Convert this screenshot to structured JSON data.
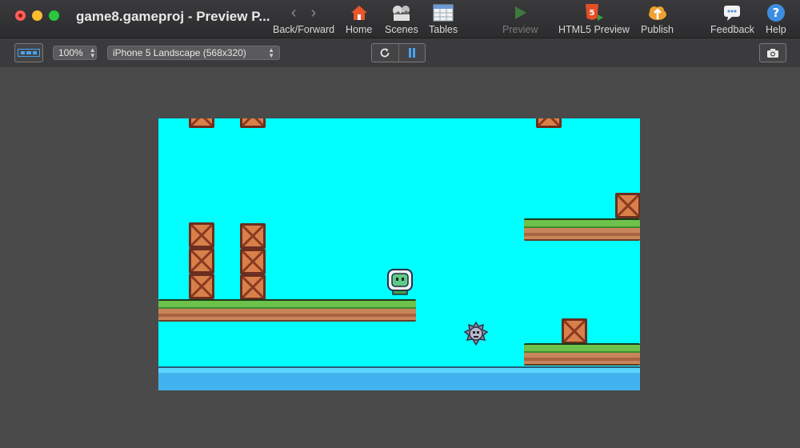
{
  "window": {
    "title": "game8.gameproj - Preview P..."
  },
  "toolbar": {
    "back_forward_label": "Back/Forward",
    "home_label": "Home",
    "scenes_label": "Scenes",
    "tables_label": "Tables",
    "preview_label": "Preview",
    "html5_preview_label": "HTML5 Preview",
    "publish_label": "Publish",
    "feedback_label": "Feedback",
    "help_label": "Help"
  },
  "subbar": {
    "zoom_value": "100%",
    "device_value": "iPhone 5 Landscape (568x320)"
  },
  "icons": {
    "layout": "layout-toggle-icon",
    "reload": "reload-icon",
    "pause": "pause-icon",
    "camera": "camera-icon"
  },
  "colors": {
    "sky": "#00ffff",
    "water": "#41b4f0",
    "pause_accent": "#4aa3f0"
  }
}
